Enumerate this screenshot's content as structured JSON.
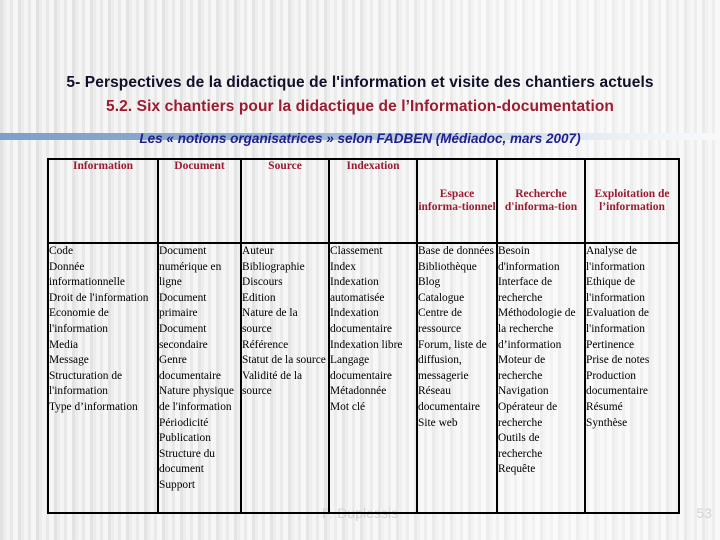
{
  "slide": {
    "title_line1": "5- Perspectives de la didactique de l'information et visite des chantiers actuels",
    "title_line2": "5.2. Six chantiers pour la didactique de l’Information-documentation",
    "subtitle": "Les « notions organisatrices » selon FADBEN (Médiadoc, mars 2007)",
    "footer_author": "P. Duplessis",
    "page_number": "53",
    "colors": {
      "title_dark": "#10102a",
      "title_red": "#9b1b30",
      "subtitle_blue": "#1f1f8f",
      "rule_blue": "#7e9fc8",
      "footer_gray": "#d2d2d2",
      "table_border": "#000000"
    }
  },
  "table": {
    "headers": [
      "Information",
      "Document",
      "Source",
      "Indexation",
      "Espace informa-tionnel",
      "Recherche d'informa-tion",
      "Exploitation de l’information"
    ],
    "columns": [
      [
        "Code",
        "Donnée informationnelle",
        "Droit de l'information",
        "Economie de l'information",
        "Media",
        "Message",
        "Structuration de l'information",
        "Type d’information"
      ],
      [
        "Document numérique en ligne",
        "Document primaire",
        "Document secondaire",
        "Genre documentaire",
        "Nature physique de l'information",
        "Périodicité",
        "Publication",
        "Structure du document",
        "Support"
      ],
      [
        "Auteur",
        "Bibliographie",
        "Discours",
        "Edition",
        "Nature de la source",
        "Référence",
        "Statut de la source",
        "Validité de la source"
      ],
      [
        "Classement",
        "Index",
        "Indexation automatisée",
        "Indexation documentaire",
        "Indexation libre",
        "Langage documentaire",
        "Métadonnée",
        "Mot clé"
      ],
      [
        "Base de données",
        "Bibliothèque",
        "Blog",
        "Catalogue",
        "Centre de ressource",
        "Forum, liste de diffusion, messagerie",
        "Réseau documentaire",
        "Site web"
      ],
      [
        "Besoin d'information",
        "Interface de recherche",
        "Méthodologie de la recherche d’information",
        "Moteur de recherche",
        "Navigation",
        "Opérateur de recherche",
        "Outils de recherche",
        "Requête"
      ],
      [
        "Analyse de l'information",
        "Ethique de l'information",
        "Evaluation de l'information",
        "Pertinence",
        "Prise de notes",
        "Production documentaire",
        "Résumé",
        "Synthèse"
      ]
    ]
  }
}
